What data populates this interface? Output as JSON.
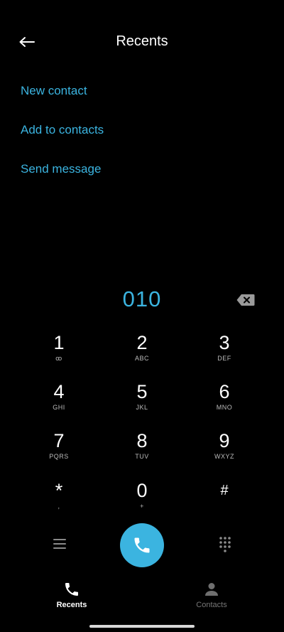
{
  "header": {
    "title": "Recents",
    "back_icon": "arrow-left-icon"
  },
  "actions": [
    {
      "label": "New contact"
    },
    {
      "label": "Add to contacts"
    },
    {
      "label": "Send message"
    }
  ],
  "dialer": {
    "number": "010",
    "backspace_icon": "backspace-icon",
    "keys": [
      {
        "digit": "1",
        "letters": "ꝏ"
      },
      {
        "digit": "2",
        "letters": "ABC"
      },
      {
        "digit": "3",
        "letters": "DEF"
      },
      {
        "digit": "4",
        "letters": "GHI"
      },
      {
        "digit": "5",
        "letters": "JKL"
      },
      {
        "digit": "6",
        "letters": "MNO"
      },
      {
        "digit": "7",
        "letters": "PQRS"
      },
      {
        "digit": "8",
        "letters": "TUV"
      },
      {
        "digit": "9",
        "letters": "WXYZ"
      },
      {
        "digit": "*",
        "letters": ","
      },
      {
        "digit": "0",
        "letters": "+"
      },
      {
        "digit": "#",
        "letters": ""
      }
    ]
  },
  "controls": {
    "menu_icon": "menu-icon",
    "call_icon": "phone-icon",
    "dialpad_icon": "dialpad-icon"
  },
  "nav": {
    "tabs": [
      {
        "label": "Recents",
        "icon": "phone-icon",
        "active": true
      },
      {
        "label": "Contacts",
        "icon": "person-icon",
        "active": false
      }
    ]
  },
  "colors": {
    "accent": "#3bb4e0",
    "background": "#000000",
    "inactive": "#777777"
  }
}
